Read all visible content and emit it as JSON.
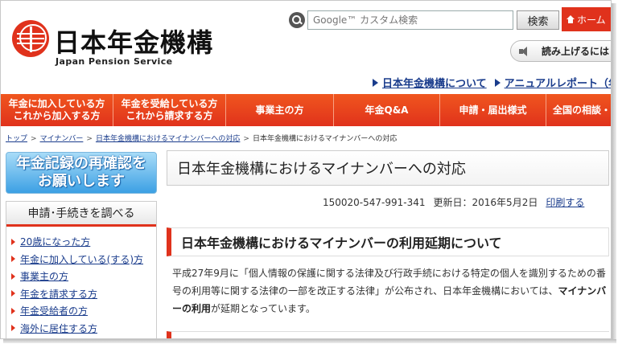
{
  "header": {
    "logo_text": "日本年金機構",
    "logo_sub": "Japan Pension Service",
    "search_placeholder": "Google™ カスタム検索",
    "search_button": "検索",
    "home_label": "ホーム",
    "read_aloud_label": "読み上げるには",
    "top_links": [
      "日本年金機構について",
      "アニュアルレポート（年"
    ]
  },
  "nav": {
    "items": [
      "年金に加入している方\nこれから加入する方",
      "年金を受給している方\nこれから請求する方",
      "事業主の方",
      "年金Q&A",
      "申請・届出様式",
      "全国の相談・手"
    ]
  },
  "breadcrumb": {
    "items": [
      "トップ",
      "マイナンバー",
      "日本年金機構におけるマイナンバーへの対応"
    ],
    "current": "日本年金機構におけるマイナンバーへの対応"
  },
  "sidebar": {
    "banner": "年金記録の再確認を\nお願いします",
    "heading": "申請･手続きを調べる",
    "items": [
      "20歳になった方",
      "年金に加入している(する)方",
      "事業主の方",
      "年金を請求する方",
      "年金受給者の方",
      "海外に居住する方"
    ]
  },
  "main": {
    "page_title": "日本年金機構におけるマイナンバーへの対応",
    "page_id": "150020-547-991-341",
    "updated": "更新日：2016年5月2日",
    "print_label": "印刷する",
    "section_title": "日本年金機構におけるマイナンバーの利用延期について",
    "body_before": "平成27年9月に「個人情報の保護に関する法律及び行政手続における特定の個人を識別するための番号の利用等に関する法律の一部を改正する法律」が公布され、日本年金機構においては、",
    "body_strong": "マイナンバーの利用",
    "body_after": "が延期となっています。"
  }
}
